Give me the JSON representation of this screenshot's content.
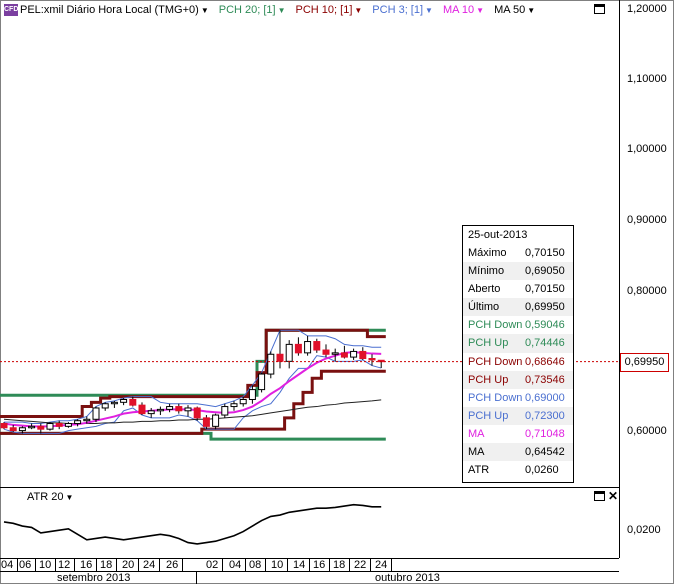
{
  "header": {
    "badge": "CFD",
    "symbol": "PEL:xmil Diário Hora Local (TMG+0)",
    "indicators": [
      {
        "label": "PCH 20; [1]",
        "color": "#2e8b57"
      },
      {
        "label": "PCH 10; [1]",
        "color": "#8b0000"
      },
      {
        "label": "PCH 3; [1]",
        "color": "#4a6fd0"
      },
      {
        "label": "MA 10",
        "color": "#e020e0"
      },
      {
        "label": "MA 50",
        "color": "#000000"
      }
    ]
  },
  "current_price": "0,69950",
  "info_panel": {
    "date": "25-out-2013",
    "rows": [
      {
        "k": "Máximo",
        "v": "0,70150",
        "color": "#000000"
      },
      {
        "k": "Mínimo",
        "v": "0,69050",
        "color": "#000000"
      },
      {
        "k": "Aberto",
        "v": "0,70150",
        "color": "#000000"
      },
      {
        "k": "Último",
        "v": "0,69950",
        "color": "#000000"
      },
      {
        "k": "PCH Down",
        "v": "0,59046",
        "color": "#2e8b57"
      },
      {
        "k": "PCH Up",
        "v": "0,74446",
        "color": "#2e8b57"
      },
      {
        "k": "PCH Down",
        "v": "0,68646",
        "color": "#8b0000"
      },
      {
        "k": "PCH Up",
        "v": "0,73546",
        "color": "#8b0000"
      },
      {
        "k": "PCH Down",
        "v": "0,69000",
        "color": "#4a6fd0"
      },
      {
        "k": "PCH Up",
        "v": "0,72300",
        "color": "#4a6fd0"
      },
      {
        "k": "MA",
        "v": "0,71048",
        "color": "#e020e0"
      },
      {
        "k": "MA",
        "v": "0,64542",
        "color": "#000000"
      },
      {
        "k": "ATR",
        "v": "0,0260",
        "color": "#000000"
      }
    ]
  },
  "atr_panel": {
    "title": "ATR 20",
    "tick_label": "0,0200"
  },
  "chart_data": {
    "type": "candlestick",
    "y_ticks": [
      "1,20000",
      "1,10000",
      "1,00000",
      "0,90000",
      "0,80000",
      "0,60000"
    ],
    "ylim": [
      0.59,
      1.2
    ],
    "date_ticks": [
      "04",
      "06",
      "10",
      "12",
      "16",
      "18",
      "20",
      "24",
      "26",
      "02",
      "04",
      "08",
      "10",
      "14",
      "16",
      "18",
      "22",
      "24"
    ],
    "months": [
      "setembro 2013",
      "outubro 2013"
    ],
    "candles": [
      [
        0.612,
        0.614,
        0.604,
        0.606
      ],
      [
        0.606,
        0.61,
        0.6,
        0.602
      ],
      [
        0.602,
        0.608,
        0.598,
        0.606
      ],
      [
        0.606,
        0.612,
        0.604,
        0.608
      ],
      [
        0.608,
        0.612,
        0.598,
        0.604
      ],
      [
        0.604,
        0.614,
        0.602,
        0.612
      ],
      [
        0.612,
        0.616,
        0.604,
        0.608
      ],
      [
        0.608,
        0.614,
        0.606,
        0.612
      ],
      [
        0.612,
        0.618,
        0.608,
        0.616
      ],
      [
        0.616,
        0.622,
        0.612,
        0.618
      ],
      [
        0.618,
        0.636,
        0.614,
        0.634
      ],
      [
        0.634,
        0.642,
        0.63,
        0.64
      ],
      [
        0.64,
        0.644,
        0.634,
        0.642
      ],
      [
        0.642,
        0.648,
        0.638,
        0.646
      ],
      [
        0.646,
        0.65,
        0.636,
        0.638
      ],
      [
        0.638,
        0.642,
        0.624,
        0.626
      ],
      [
        0.626,
        0.634,
        0.62,
        0.63
      ],
      [
        0.63,
        0.636,
        0.624,
        0.632
      ],
      [
        0.632,
        0.64,
        0.628,
        0.636
      ],
      [
        0.636,
        0.64,
        0.626,
        0.63
      ],
      [
        0.63,
        0.638,
        0.622,
        0.634
      ],
      [
        0.634,
        0.636,
        0.616,
        0.62
      ],
      [
        0.62,
        0.624,
        0.604,
        0.608
      ],
      [
        0.608,
        0.626,
        0.604,
        0.624
      ],
      [
        0.624,
        0.64,
        0.62,
        0.636
      ],
      [
        0.636,
        0.644,
        0.63,
        0.64
      ],
      [
        0.64,
        0.65,
        0.636,
        0.646
      ],
      [
        0.646,
        0.666,
        0.64,
        0.66
      ],
      [
        0.66,
        0.684,
        0.656,
        0.682
      ],
      [
        0.682,
        0.714,
        0.676,
        0.71
      ],
      [
        0.71,
        0.744,
        0.69,
        0.7
      ],
      [
        0.7,
        0.73,
        0.69,
        0.724
      ],
      [
        0.724,
        0.734,
        0.708,
        0.712
      ],
      [
        0.712,
        0.736,
        0.708,
        0.728
      ],
      [
        0.728,
        0.732,
        0.712,
        0.716
      ],
      [
        0.716,
        0.724,
        0.706,
        0.71
      ],
      [
        0.71,
        0.718,
        0.7,
        0.712
      ],
      [
        0.712,
        0.722,
        0.704,
        0.706
      ],
      [
        0.706,
        0.718,
        0.702,
        0.714
      ],
      [
        0.714,
        0.72,
        0.702,
        0.704
      ],
      [
        0.704,
        0.71,
        0.694,
        0.702
      ],
      [
        0.7015,
        0.7015,
        0.6905,
        0.6995
      ]
    ],
    "pch20_up": [
      0.652,
      0.652,
      0.652,
      0.652,
      0.652,
      0.652,
      0.652,
      0.652,
      0.652,
      0.652,
      0.652,
      0.652,
      0.652,
      0.652,
      0.652,
      0.652,
      0.652,
      0.652,
      0.652,
      0.652,
      0.652,
      0.652,
      0.652,
      0.652,
      0.652,
      0.652,
      0.652,
      0.652,
      0.7,
      0.744,
      0.744,
      0.744,
      0.744,
      0.744,
      0.744,
      0.744,
      0.744,
      0.744,
      0.744,
      0.744,
      0.744,
      0.744
    ],
    "pch20_down": [
      0.598,
      0.598,
      0.598,
      0.598,
      0.598,
      0.598,
      0.598,
      0.598,
      0.598,
      0.598,
      0.598,
      0.598,
      0.598,
      0.598,
      0.598,
      0.598,
      0.598,
      0.598,
      0.598,
      0.598,
      0.598,
      0.598,
      0.598,
      0.59,
      0.59,
      0.59,
      0.59,
      0.59,
      0.59,
      0.59,
      0.59,
      0.59,
      0.59,
      0.59,
      0.59,
      0.59,
      0.59,
      0.59,
      0.59,
      0.59,
      0.59,
      0.59
    ],
    "pch10_up": [
      0.622,
      0.622,
      0.622,
      0.622,
      0.622,
      0.622,
      0.622,
      0.622,
      0.622,
      0.636,
      0.642,
      0.648,
      0.65,
      0.65,
      0.65,
      0.65,
      0.65,
      0.65,
      0.65,
      0.65,
      0.65,
      0.65,
      0.65,
      0.65,
      0.65,
      0.65,
      0.65,
      0.666,
      0.684,
      0.744,
      0.744,
      0.744,
      0.744,
      0.744,
      0.744,
      0.744,
      0.744,
      0.744,
      0.744,
      0.744,
      0.735,
      0.735
    ],
    "pch10_down": [
      0.598,
      0.598,
      0.598,
      0.598,
      0.598,
      0.598,
      0.598,
      0.598,
      0.598,
      0.598,
      0.598,
      0.598,
      0.598,
      0.598,
      0.598,
      0.598,
      0.598,
      0.598,
      0.598,
      0.598,
      0.598,
      0.598,
      0.604,
      0.604,
      0.604,
      0.604,
      0.604,
      0.604,
      0.604,
      0.604,
      0.604,
      0.62,
      0.64,
      0.656,
      0.676,
      0.686,
      0.686,
      0.686,
      0.686,
      0.686,
      0.686,
      0.686
    ],
    "ma10": [
      0.612,
      0.61,
      0.609,
      0.608,
      0.608,
      0.608,
      0.609,
      0.61,
      0.611,
      0.613,
      0.616,
      0.619,
      0.622,
      0.626,
      0.628,
      0.629,
      0.63,
      0.631,
      0.632,
      0.632,
      0.632,
      0.631,
      0.629,
      0.628,
      0.627,
      0.628,
      0.631,
      0.636,
      0.644,
      0.654,
      0.662,
      0.672,
      0.681,
      0.69,
      0.698,
      0.704,
      0.708,
      0.712,
      0.713,
      0.712,
      0.711,
      0.7105
    ],
    "ma50": [
      0.618,
      0.617,
      0.616,
      0.615,
      0.614,
      0.613,
      0.613,
      0.612,
      0.612,
      0.612,
      0.612,
      0.613,
      0.613,
      0.614,
      0.614,
      0.615,
      0.615,
      0.616,
      0.616,
      0.617,
      0.617,
      0.618,
      0.618,
      0.619,
      0.62,
      0.621,
      0.622,
      0.623,
      0.625,
      0.627,
      0.629,
      0.631,
      0.633,
      0.635,
      0.636,
      0.638,
      0.639,
      0.641,
      0.642,
      0.643,
      0.644,
      0.6454
    ],
    "atr_values": [
      0.0238,
      0.0236,
      0.0232,
      0.023,
      0.0222,
      0.0224,
      0.0226,
      0.0228,
      0.022,
      0.0212,
      0.0214,
      0.0216,
      0.0214,
      0.0212,
      0.0214,
      0.0216,
      0.0218,
      0.022,
      0.0218,
      0.0214,
      0.0208,
      0.0206,
      0.0208,
      0.021,
      0.0214,
      0.0218,
      0.0224,
      0.0232,
      0.024,
      0.0246,
      0.0248,
      0.0252,
      0.0254,
      0.0256,
      0.0258,
      0.0258,
      0.0259,
      0.0261,
      0.0263,
      0.0262,
      0.026,
      0.026
    ],
    "atr_ylim": [
      0.019,
      0.028
    ]
  }
}
